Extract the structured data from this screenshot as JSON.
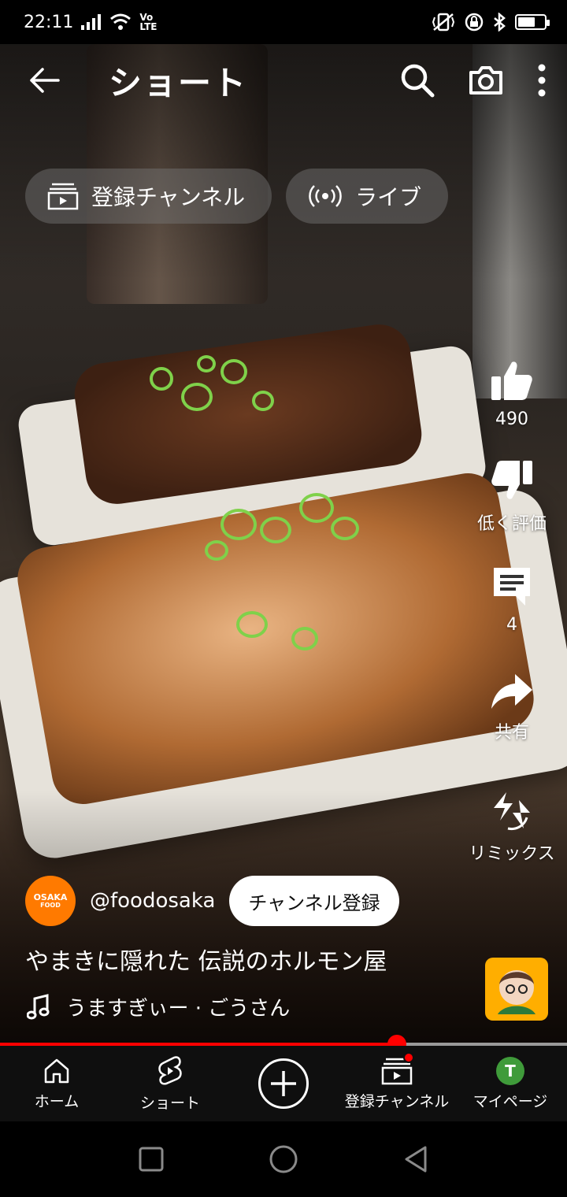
{
  "status": {
    "time": "22:11",
    "network": "Vo LTE",
    "battery_percent": 70
  },
  "topbar": {
    "title": "ショート"
  },
  "chips": [
    {
      "label": "登録チャンネル",
      "icon": "subscriptions-icon"
    },
    {
      "label": "ライブ",
      "icon": "live-icon"
    }
  ],
  "rail": {
    "like_count": "490",
    "dislike_label": "低く評価",
    "comment_count": "4",
    "share_label": "共有",
    "remix_label": "リミックス"
  },
  "channel": {
    "avatar_text_top": "OSAKA",
    "avatar_text_bottom": "FOOD",
    "handle": "@foodosaka",
    "subscribe_label": "チャンネル登録"
  },
  "video": {
    "title": "やまきに隠れた 伝説のホルモン屋",
    "music": "うますぎぃー · ごうさん",
    "progress": 0.7
  },
  "nav": {
    "items": [
      {
        "label": "ホーム",
        "icon": "home-icon"
      },
      {
        "label": "ショート",
        "icon": "shorts-icon"
      },
      {
        "label": "",
        "icon": "create-icon"
      },
      {
        "label": "登録チャンネル",
        "icon": "subscriptions-icon"
      },
      {
        "label": "マイページ",
        "icon": "user-avatar",
        "avatar_letter": "T"
      }
    ]
  },
  "colors": {
    "accent": "#ff0000",
    "nav_bg": "#0f0f0f",
    "avatar_orange": "#ff7a00",
    "user_avatar_green": "#3f9b3a"
  }
}
